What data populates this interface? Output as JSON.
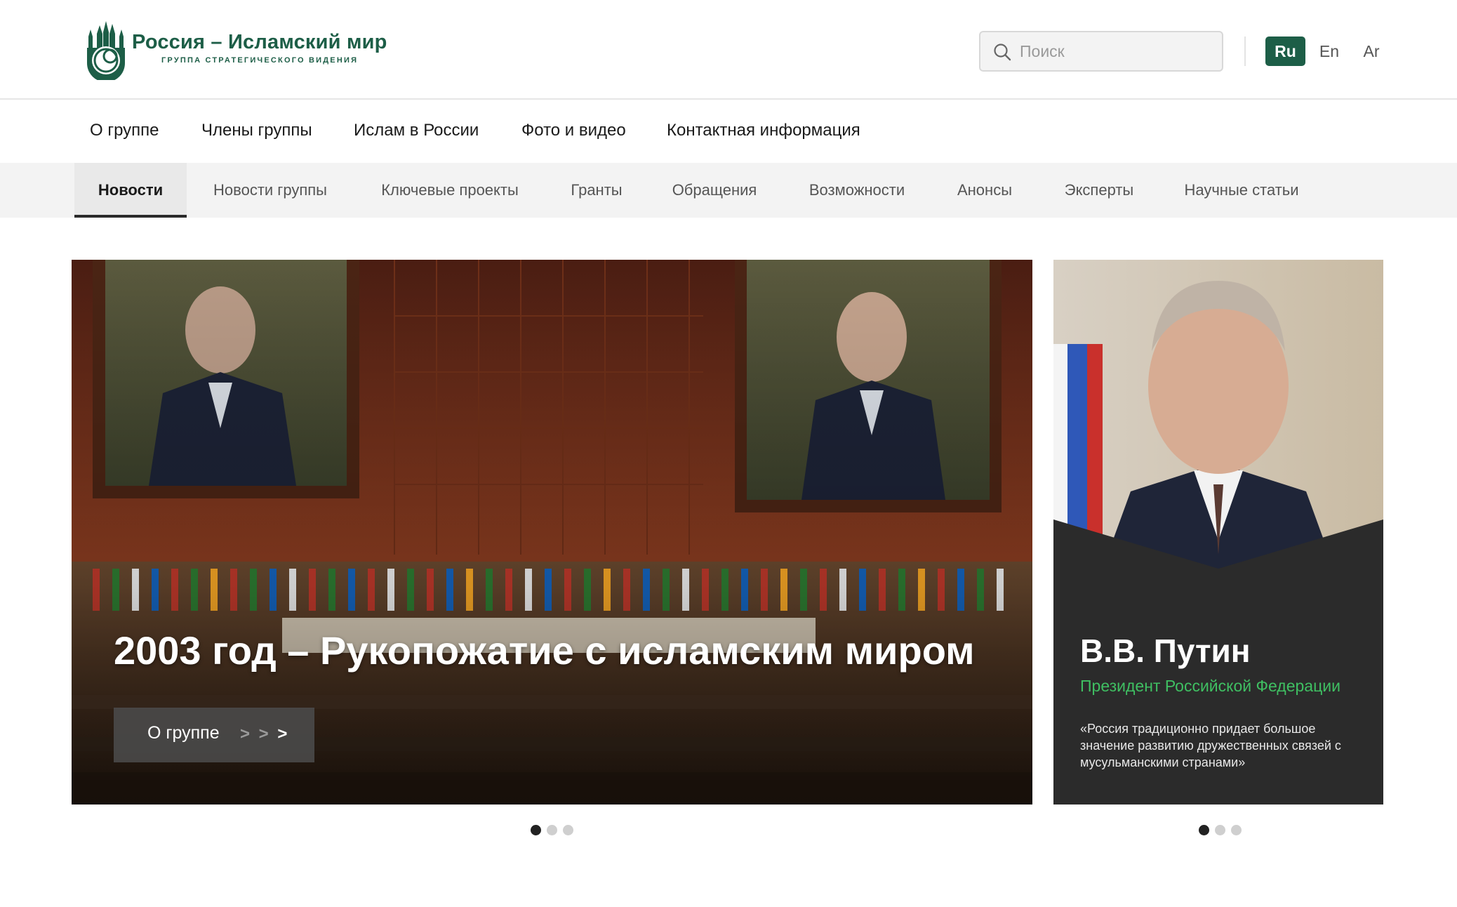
{
  "brand": {
    "title": "Россия – Исламский мир",
    "subtitle": "ГРУППА СТРАТЕГИЧЕСКОГО ВИДЕНИЯ",
    "color": "#1d5e47"
  },
  "search": {
    "placeholder": "Поиск",
    "icon": "search-icon"
  },
  "languages": [
    {
      "label": "Ru",
      "active": true
    },
    {
      "label": "En",
      "active": false
    },
    {
      "label": "Ar",
      "active": false
    }
  ],
  "main_nav": [
    "О группе",
    "Члены группы",
    "Ислам в России",
    "Фото и видео",
    "Контактная информация"
  ],
  "sub_nav": {
    "active_index": 0,
    "tabs": [
      "Новости",
      "Новости группы",
      "Ключевые проекты",
      "Гранты",
      "Обращения",
      "Возможности",
      "Анонсы",
      "Эксперты",
      "Научные статьи"
    ]
  },
  "hero": {
    "title": "2003 год – Рукопожатие с исламским миром",
    "button_label": "О группе",
    "button_arrows_dim": "> >",
    "button_arrows_bright": ">",
    "slides": 3,
    "active_slide": 0
  },
  "side_card": {
    "name": "В.В. Путин",
    "role": "Президент Российской Федерации",
    "quote": "«Россия традиционно придает большое значение развитию дружественных связей с мусульманскими странами»",
    "role_color": "#3fbf62",
    "slides": 3,
    "active_slide": 0
  }
}
